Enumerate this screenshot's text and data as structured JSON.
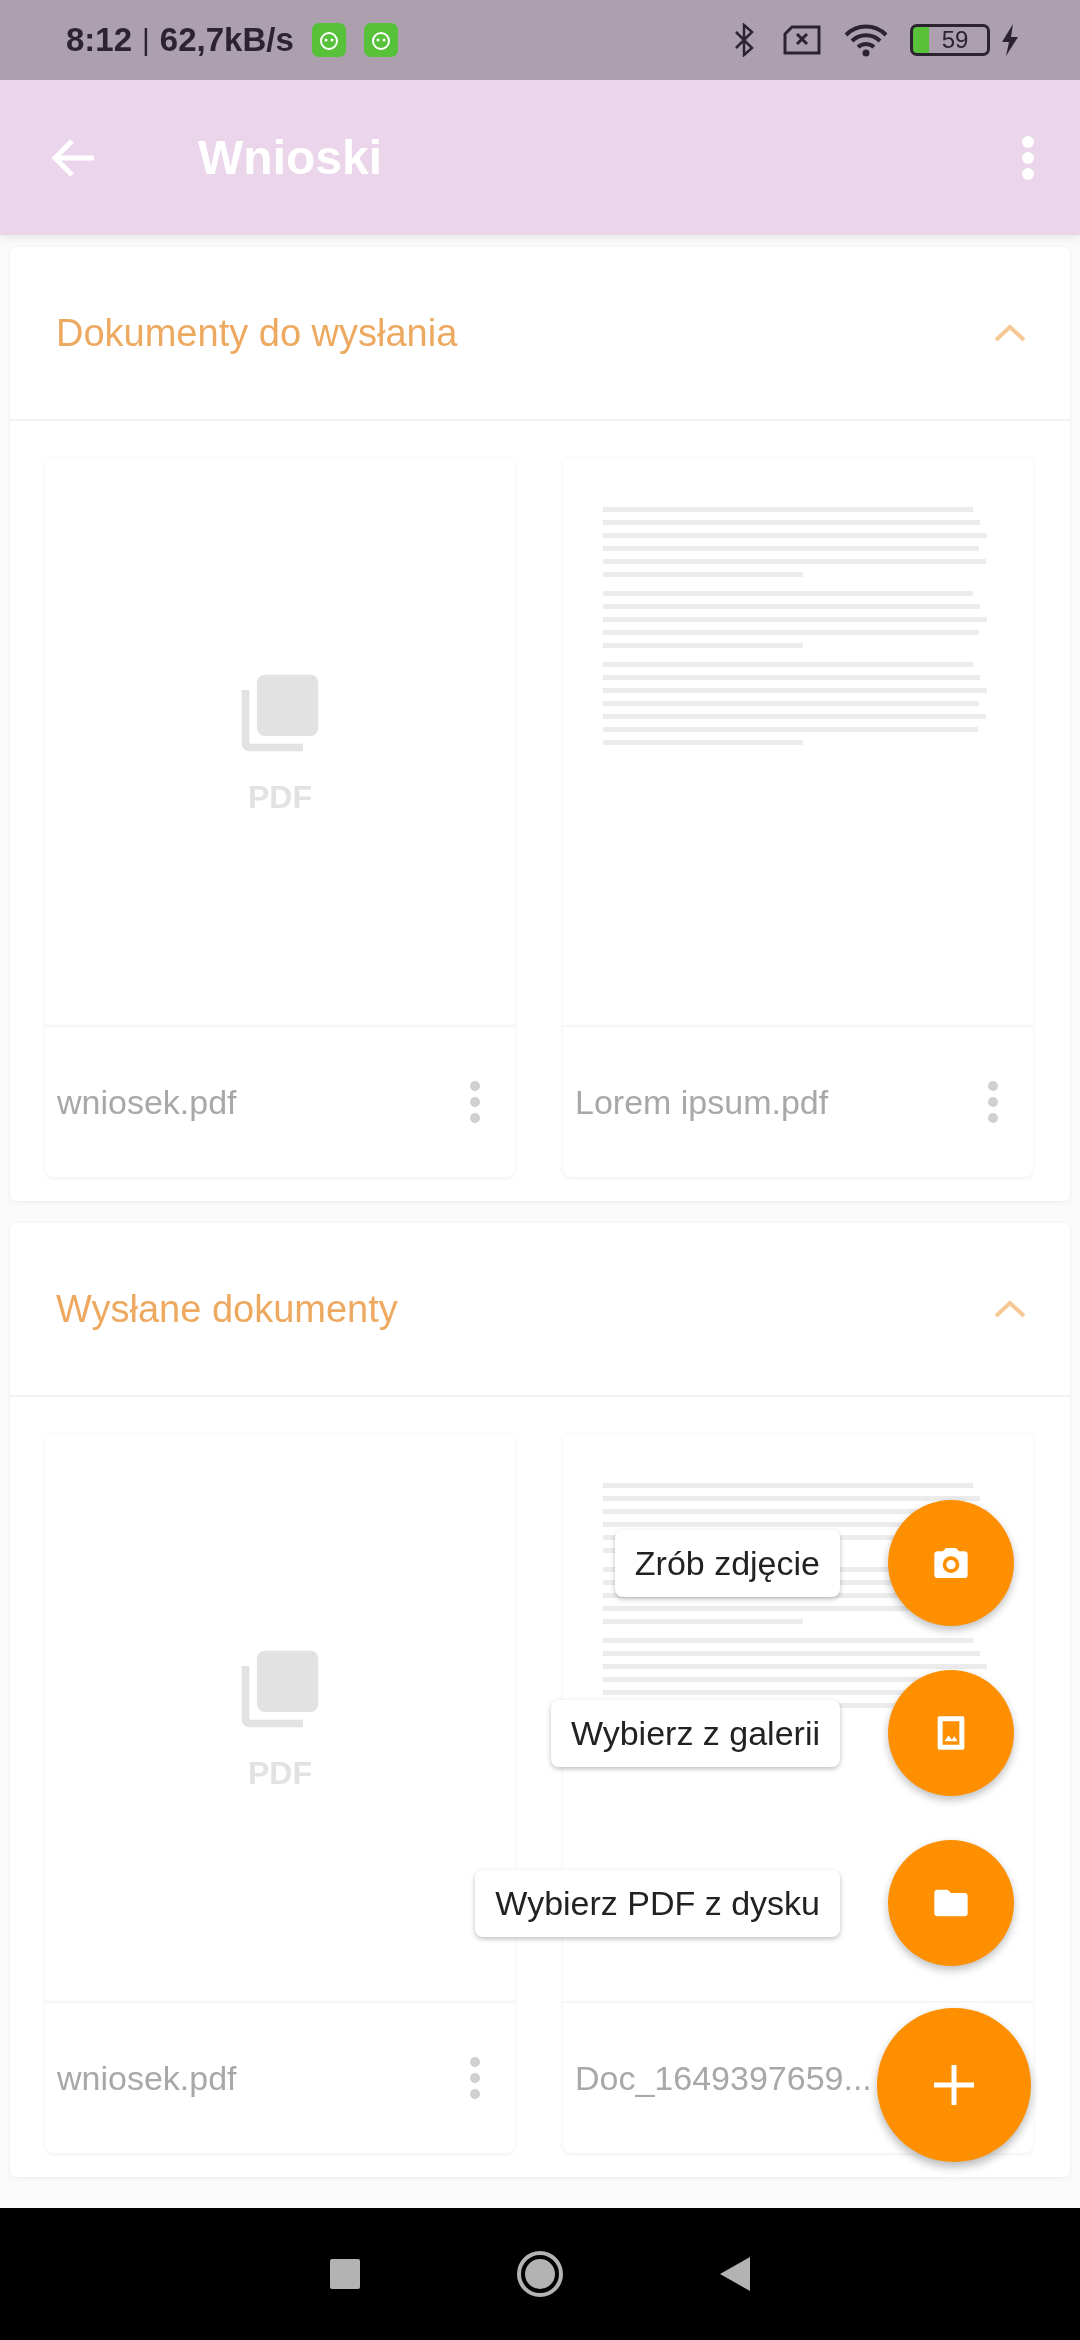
{
  "status_bar": {
    "time": "8:12",
    "separator": "|",
    "speed": "62,7kB/s",
    "battery": "59",
    "charging": true
  },
  "app_bar": {
    "title": "Wnioski"
  },
  "sections": [
    {
      "title": "Dokumenty do wysłania",
      "expanded": true,
      "documents": [
        {
          "kind": "pdf",
          "preview_label": "PDF",
          "name": "wniosek.pdf",
          "menu_button": true
        },
        {
          "kind": "page",
          "name": "Lorem ipsum.pdf",
          "menu_button": true
        }
      ]
    },
    {
      "title": "Wysłane dokumenty",
      "expanded": true,
      "documents": [
        {
          "kind": "pdf",
          "preview_label": "PDF",
          "name": "wniosek.pdf",
          "menu_button": true
        },
        {
          "kind": "page",
          "name": "Doc_1649397659...",
          "menu_button": false
        }
      ]
    }
  ],
  "fab_menu": {
    "actions": [
      {
        "kind": "camera",
        "label": "Zrób zdjęcie"
      },
      {
        "kind": "gallery",
        "label": "Wybierz z galerii"
      },
      {
        "kind": "folder",
        "label": "Wybierz PDF z dysku"
      }
    ]
  }
}
